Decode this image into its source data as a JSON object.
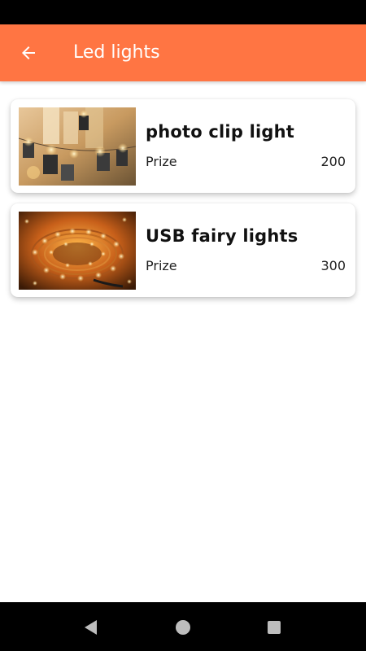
{
  "app_bar": {
    "title": "Led lights",
    "back_icon": "arrow-left-icon",
    "background_color": "#ff7543"
  },
  "products": [
    {
      "name": "photo clip light",
      "price_label": "Prize",
      "price": "200",
      "image_icon": "photo-clip-light-image"
    },
    {
      "name": "USB fairy lights",
      "price_label": "Prize",
      "price": "300",
      "image_icon": "usb-fairy-lights-image"
    }
  ],
  "nav_bar": {
    "back_icon": "triangle-back-icon",
    "home_icon": "circle-home-icon",
    "recents_icon": "square-recents-icon"
  }
}
